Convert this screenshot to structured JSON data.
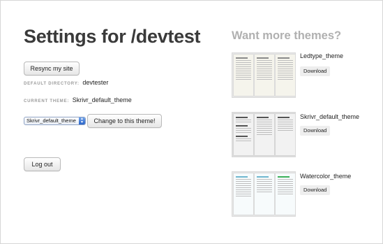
{
  "page": {
    "title": "Settings for /devtest"
  },
  "actions": {
    "resync_label": "Resync my site",
    "change_theme_label": "Change to this theme!",
    "logout_label": "Log out"
  },
  "settings": {
    "directory_key": "DEFAULT DIRECTORY:",
    "directory_value": "devtester",
    "theme_key": "CURRENT THEME:",
    "theme_value": "Skrivr_default_theme",
    "theme_select_value": "Skrivr_default_theme"
  },
  "sidebar": {
    "title": "Want more themes?",
    "themes": [
      {
        "name": "Ledtype_theme",
        "download_label": "Download"
      },
      {
        "name": "Skrivr_default_theme",
        "download_label": "Download"
      },
      {
        "name": "Watercolor_theme",
        "download_label": "Download"
      }
    ]
  },
  "icons": {
    "select_arrows": "updown-arrows-icon"
  },
  "colors": {
    "title": "#3a3a3a",
    "sidebar_title": "#b0b0b0",
    "select_accent": "#2a64c8"
  }
}
